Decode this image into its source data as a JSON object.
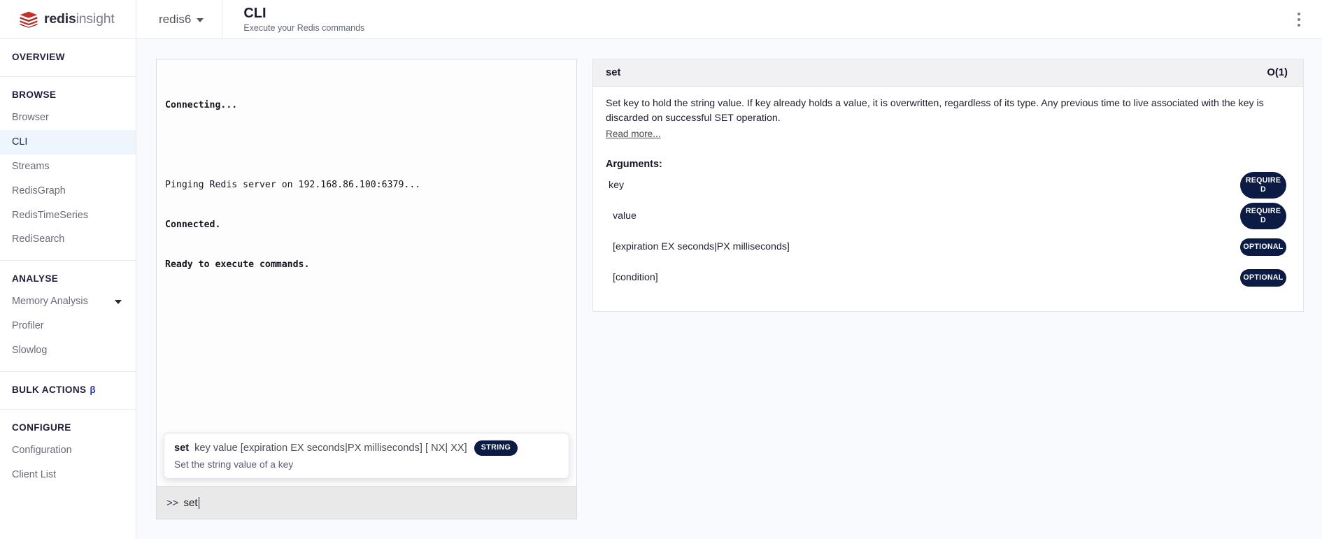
{
  "header": {
    "brand_bold": "redis",
    "brand_light": "insight",
    "logo_icon": "redis-logo-icon",
    "database_name": "redis6",
    "database_caret_icon": "chevron-down-icon",
    "page_title": "CLI",
    "page_subtitle": "Execute your Redis commands",
    "menu_icon": "kebab-menu-icon"
  },
  "sidebar": {
    "groups": [
      {
        "heading": "OVERVIEW",
        "items": []
      },
      {
        "heading": "BROWSE",
        "items": [
          {
            "label": "Browser",
            "active": false
          },
          {
            "label": "CLI",
            "active": true
          },
          {
            "label": "Streams",
            "active": false
          },
          {
            "label": "RedisGraph",
            "active": false
          },
          {
            "label": "RedisTimeSeries",
            "active": false
          },
          {
            "label": "RediSearch",
            "active": false
          }
        ]
      },
      {
        "heading": "ANALYSE",
        "items": [
          {
            "label": "Memory Analysis",
            "active": false,
            "caret_icon": "caret-down-icon"
          },
          {
            "label": "Profiler",
            "active": false
          },
          {
            "label": "Slowlog",
            "active": false
          }
        ]
      },
      {
        "heading": "BULK ACTIONS",
        "beta_mark": "β",
        "items": []
      },
      {
        "heading": "CONFIGURE",
        "items": [
          {
            "label": "Configuration",
            "active": false
          },
          {
            "label": "Client List",
            "active": false
          }
        ]
      }
    ]
  },
  "cli": {
    "output_lines": [
      {
        "text": "Connecting...",
        "bold": true
      },
      {
        "text": "",
        "bold": false
      },
      {
        "text": "Pinging Redis server on 192.168.86.100:6379...",
        "bold": false
      },
      {
        "text": "Connected.",
        "bold": true
      },
      {
        "text": "Ready to execute commands.",
        "bold": true
      }
    ],
    "suggestion": {
      "command": "set",
      "arguments": "key value [expiration EX seconds|PX milliseconds] [ NX| XX]",
      "type_badge": "STRING",
      "description": "Set the string value of a key"
    },
    "prompt_sign": ">>",
    "prompt_value": "set"
  },
  "help": {
    "command": "set",
    "complexity": "O(1)",
    "description": "Set key to hold the string value. If key already holds a value, it is overwritten, regardless of its type. Any previous time to live associated with the key is discarded on successful SET operation.",
    "read_more": "Read more...",
    "arguments_title": "Arguments:",
    "arguments": [
      {
        "name": "key",
        "badge": "REQUIRED"
      },
      {
        "name": "value",
        "badge": "REQUIRED"
      },
      {
        "name": "[expiration EX seconds|PX milliseconds]",
        "badge": "OPTIONAL"
      },
      {
        "name": "[condition]",
        "badge": "OPTIONAL"
      }
    ]
  },
  "colors": {
    "accent_navy": "#0c1b44",
    "brand_red": "#c6302b",
    "active_nav_bg": "#eef5fc",
    "canvas_bg": "#f9fafd"
  }
}
